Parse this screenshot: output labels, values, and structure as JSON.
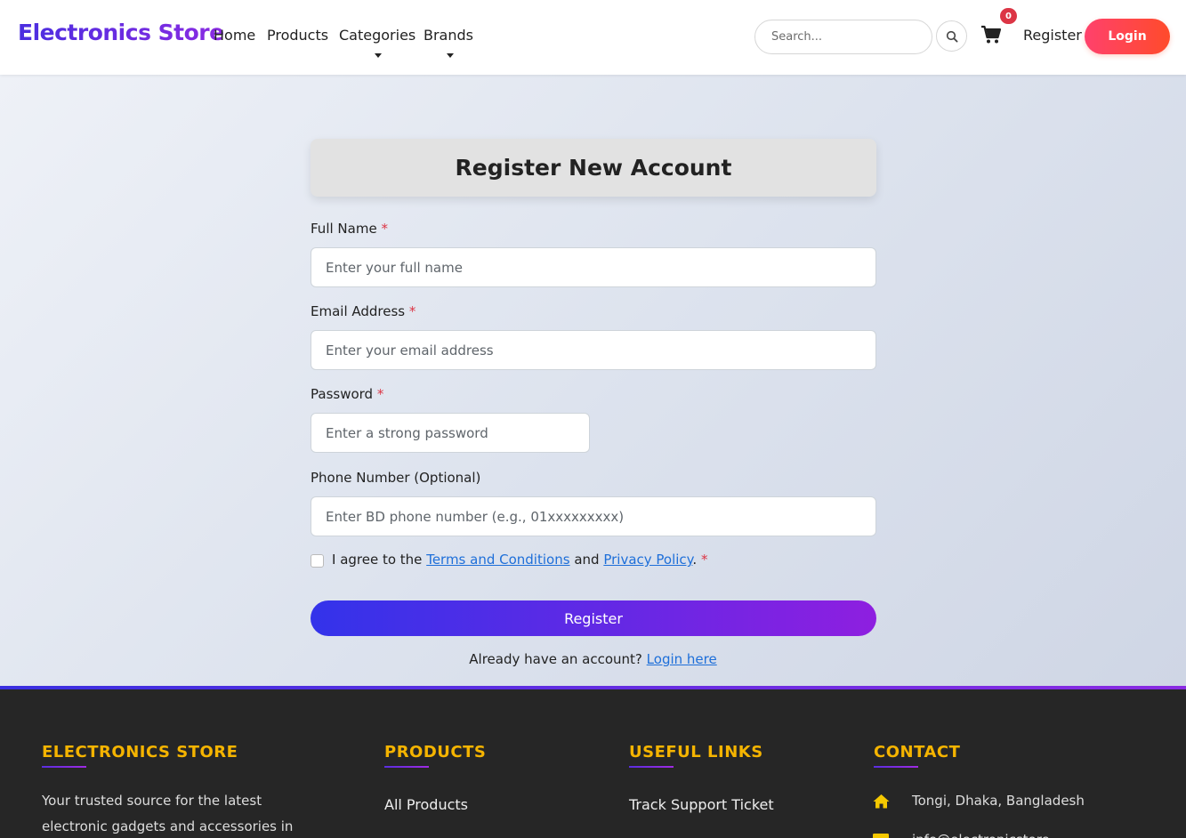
{
  "header": {
    "brand": "Electronics Store",
    "nav": {
      "home": "Home",
      "products": "Products",
      "categories": "Categories",
      "brands": "Brands"
    },
    "search_placeholder": "Search...",
    "cart_count": "0",
    "register": "Register",
    "login": "Login"
  },
  "form": {
    "title": "Register New Account",
    "full_name_label": "Full Name",
    "full_name_placeholder": "Enter your full name",
    "email_label": "Email Address",
    "email_placeholder": "Enter your email address",
    "password_label": "Password",
    "password_placeholder": "Enter a strong password",
    "phone_label": "Phone Number (Optional)",
    "phone_placeholder": "Enter BD phone number (e.g., 01xxxxxxxxx)",
    "required_mark": "*",
    "agree_prefix": "I agree to the",
    "terms_link": "Terms and Conditions",
    "agree_and": "and",
    "privacy_link": "Privacy Policy",
    "agree_suffix": ".",
    "submit": "Register",
    "have_account": "Already have an account?",
    "login_link": "Login here"
  },
  "footer": {
    "about_heading": "ELECTRONICS STORE",
    "about_text": "Your trusted source for the latest electronic gadgets and accessories in",
    "products_heading": "PRODUCTS",
    "products_link_1": "All Products",
    "useful_heading": "USEFUL LINKS",
    "useful_link_1": "Track Support Ticket",
    "contact_heading": "CONTACT",
    "contact_address": "Tongi, Dhaka, Bangladesh",
    "contact_email_partial": "info@electronicstore"
  },
  "colors": {
    "brand_gradient": [
      "#4a2ee0",
      "#8a2be2"
    ],
    "login_gradient": [
      "#ff416c",
      "#ff4b2b"
    ],
    "footer_heading": "#f5b400",
    "link": "#1e6fd9",
    "required": "#dc3545"
  },
  "icons": [
    "search-icon",
    "cart-icon",
    "caret-down-icon",
    "home-icon",
    "envelope-icon"
  ]
}
